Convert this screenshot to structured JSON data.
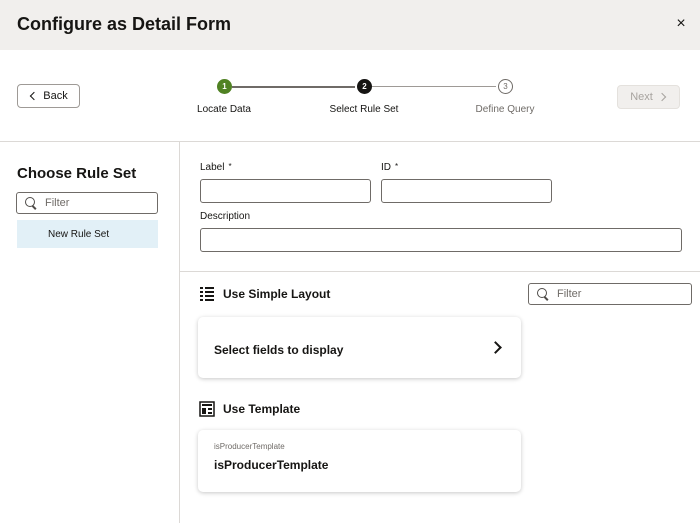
{
  "dialog": {
    "title": "Configure as Detail Form",
    "close_icon": "×"
  },
  "train": {
    "back_label": "Back",
    "next_label": "Next",
    "steps": [
      {
        "number": "1",
        "label": "Locate Data",
        "state": "done"
      },
      {
        "number": "2",
        "label": "Select Rule Set",
        "state": "current"
      },
      {
        "number": "3",
        "label": "Define Query",
        "state": "todo"
      }
    ]
  },
  "left": {
    "title": "Choose Rule Set",
    "filter_placeholder": "Filter",
    "items": [
      {
        "label": "New Rule Set",
        "selected": true
      }
    ]
  },
  "form": {
    "label_label": "Label",
    "id_label": "ID",
    "required_mark": "*",
    "description_label": "Description",
    "label_value": "",
    "id_value": "",
    "description_value": ""
  },
  "layout": {
    "simple_title": "Use Simple Layout",
    "filter_placeholder": "Filter",
    "select_fields_label": "Select fields to display",
    "template_title": "Use Template",
    "template_card": {
      "sub": "isProducerTemplate",
      "name": "isProducerTemplate"
    }
  },
  "colors": {
    "done_step": "#508223",
    "current_step": "#161513",
    "selected_item": "#e2f0f7",
    "header_bg": "#f1efed"
  }
}
